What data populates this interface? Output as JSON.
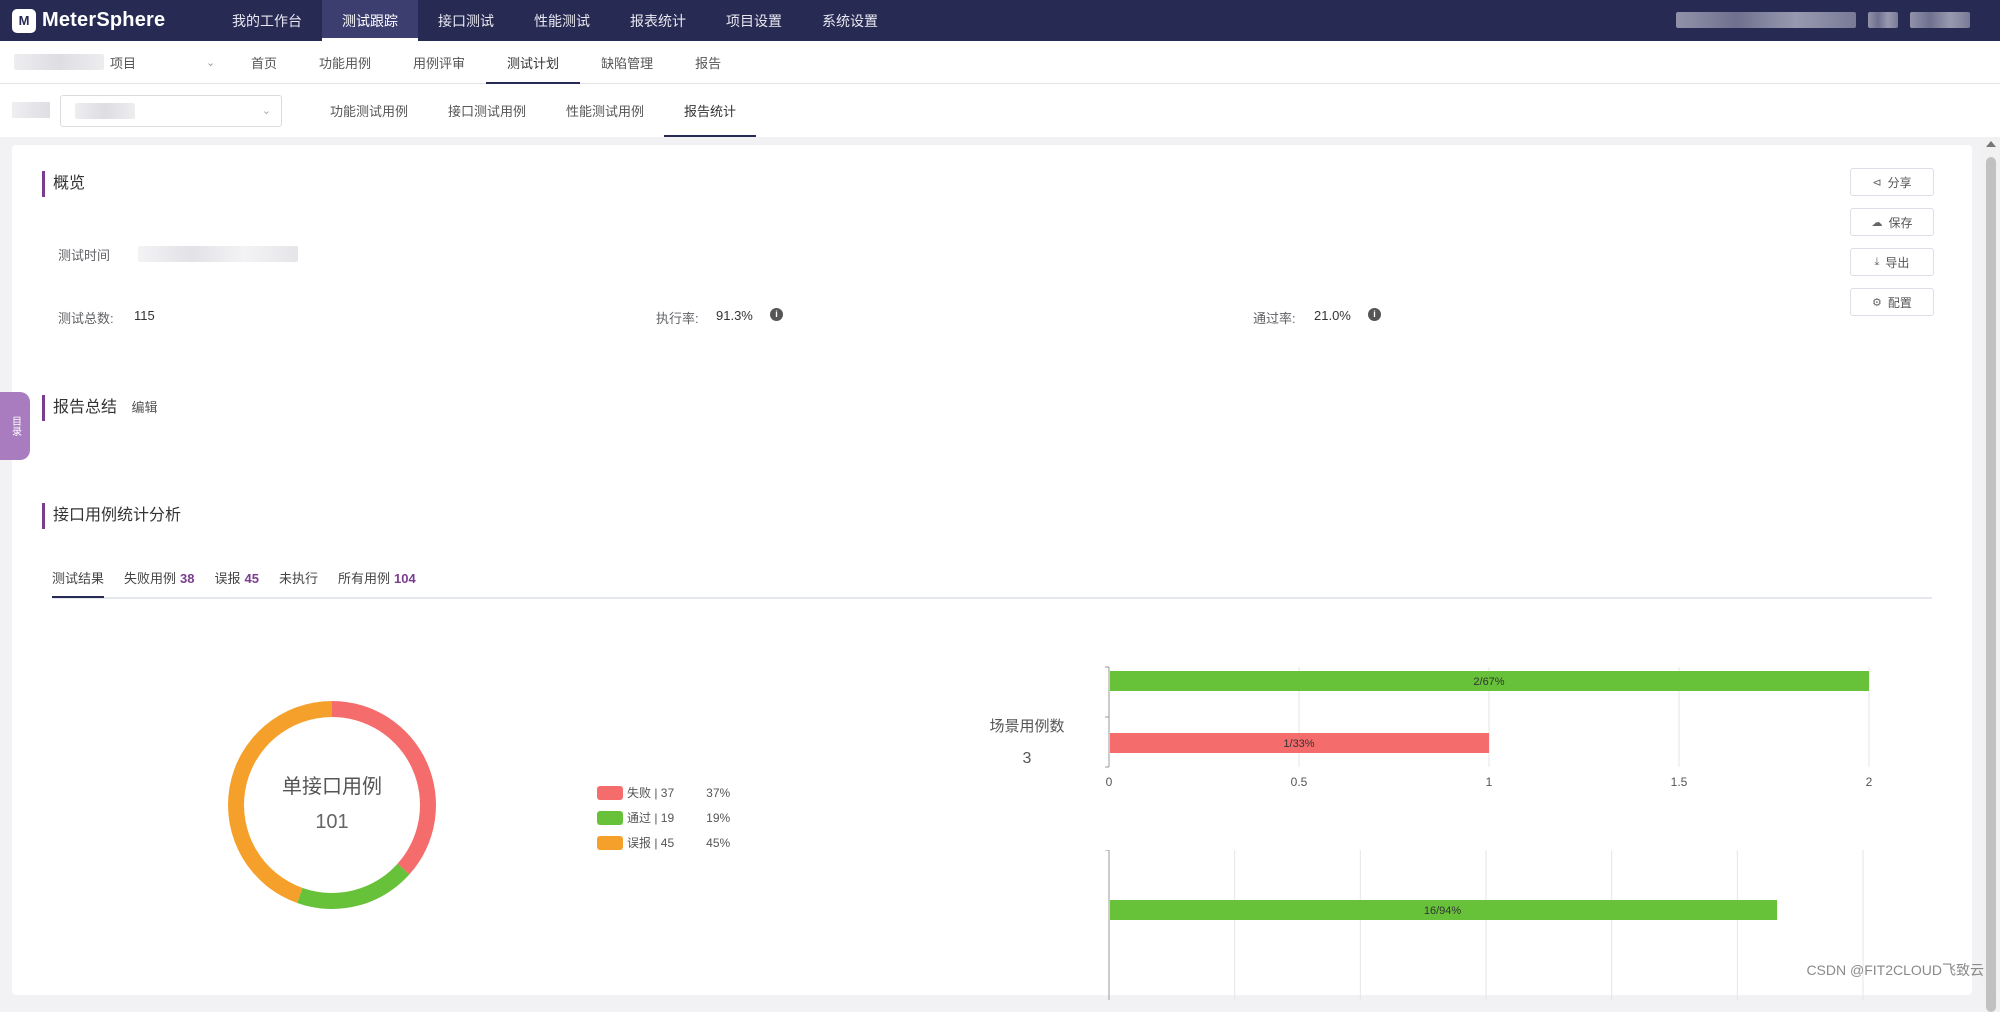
{
  "app": {
    "name": "MeterSphere"
  },
  "topnav": {
    "items": [
      "我的工作台",
      "测试跟踪",
      "接口测试",
      "性能测试",
      "报表统计",
      "项目设置",
      "系统设置"
    ],
    "active_index": 1
  },
  "subnav": {
    "project_suffix": "项目",
    "items": [
      "首页",
      "功能用例",
      "用例评审",
      "测试计划",
      "缺陷管理",
      "报告"
    ],
    "active_index": 3
  },
  "plan_tabs": {
    "items": [
      "功能测试用例",
      "接口测试用例",
      "性能测试用例",
      "报告统计"
    ],
    "active_index": 3
  },
  "overview": {
    "title": "概览",
    "time_label": "测试时间",
    "total_label": "测试总数:",
    "total_value": "115",
    "exec_label": "执行率:",
    "exec_value": "91.3%",
    "pass_label": "通过率:",
    "pass_value": "21.0%"
  },
  "actions": {
    "share": "分享",
    "save": "保存",
    "export": "导出",
    "config": "配置"
  },
  "drawer_tab": {
    "label": "目录"
  },
  "summary": {
    "title": "报告总结",
    "edit": "编辑"
  },
  "analysis": {
    "title": "接口用例统计分析",
    "tabs": [
      {
        "label": "测试结果",
        "count": ""
      },
      {
        "label": "失败用例",
        "count": "38"
      },
      {
        "label": "误报",
        "count": "45"
      },
      {
        "label": "未执行",
        "count": ""
      },
      {
        "label": "所有用例",
        "count": "104"
      }
    ],
    "active_tab": 0
  },
  "colors": {
    "fail": "#f56c6c",
    "pass": "#67c23a",
    "false_alarm": "#f5a02a",
    "nav": "#272a52",
    "accent": "#7a3e8f"
  },
  "chart_data": [
    {
      "type": "pie",
      "title": "单接口用例",
      "center_value": "101",
      "legend": [
        "失败 | 37",
        "通过 | 19",
        "误报 | 45"
      ],
      "legend_pct": [
        "37%",
        "19%",
        "45%"
      ],
      "slices": [
        {
          "name": "失败",
          "value": 37,
          "color": "#f56c6c"
        },
        {
          "name": "通过",
          "value": 19,
          "color": "#67c23a"
        },
        {
          "name": "误报",
          "value": 45,
          "color": "#f5a02a"
        }
      ]
    },
    {
      "type": "bar",
      "orientation": "horizontal",
      "title": "场景用例数",
      "center_value": "3",
      "xlim": [
        0,
        2
      ],
      "xticks": [
        "0",
        "0.5",
        "1",
        "1.5",
        "2"
      ],
      "bars": [
        {
          "value": 2,
          "label": "2/67%",
          "color": "#67c23a"
        },
        {
          "value": 1,
          "label": "1/33%",
          "color": "#f56c6c"
        }
      ]
    },
    {
      "type": "bar",
      "orientation": "horizontal",
      "bars": [
        {
          "value": 16,
          "label": "16/94%",
          "color": "#67c23a"
        }
      ]
    }
  ],
  "watermark": "CSDN @FIT2CLOUD飞致云"
}
